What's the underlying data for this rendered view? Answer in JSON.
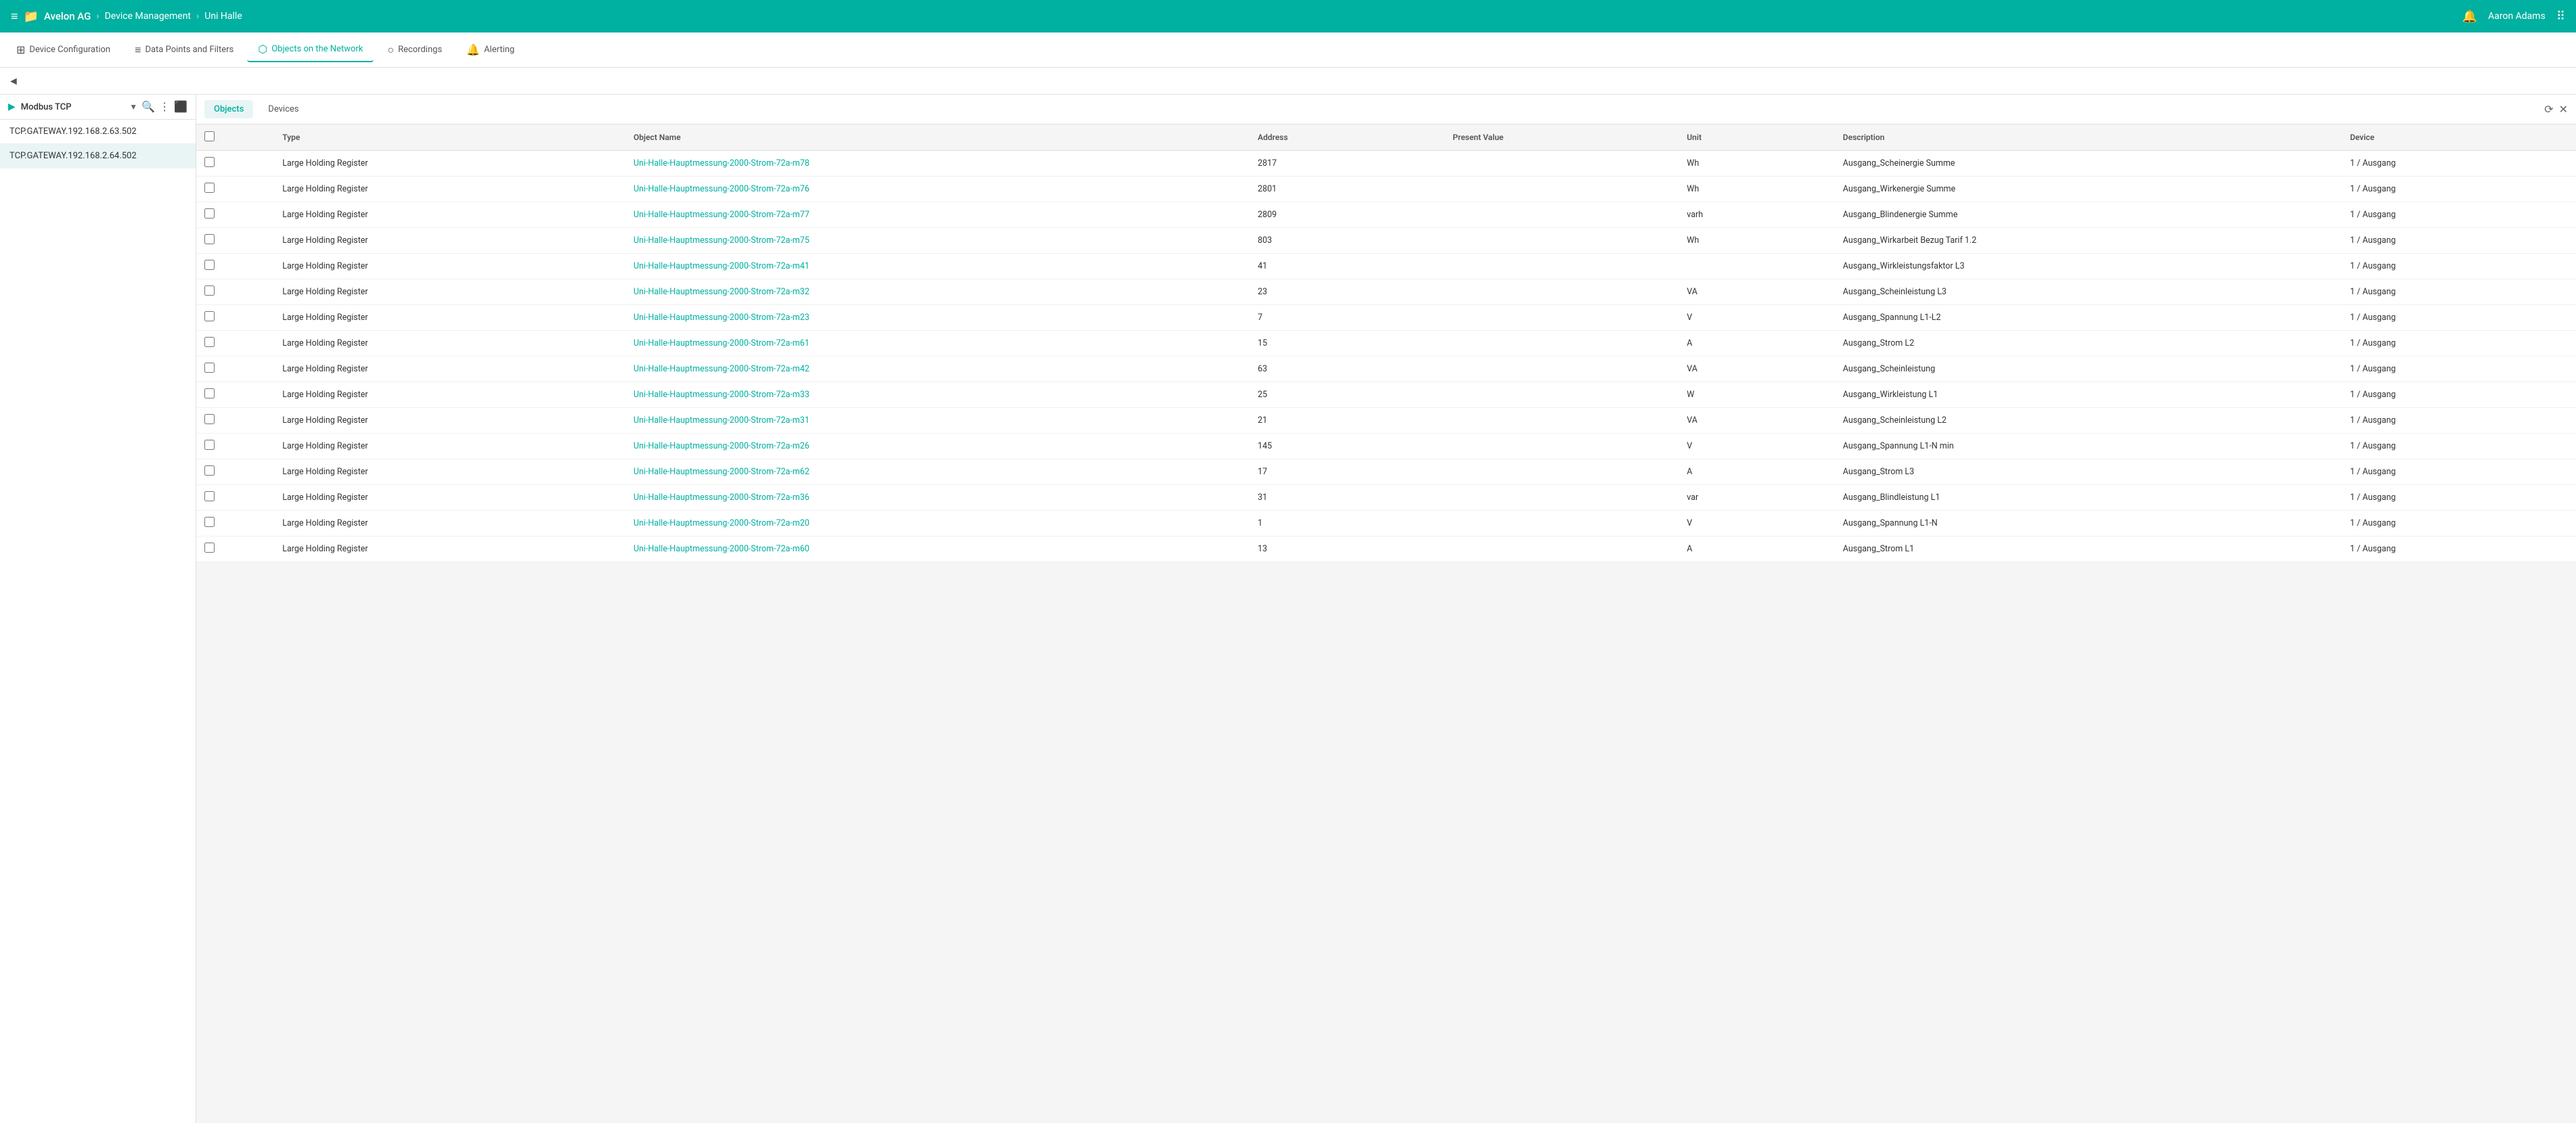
{
  "topNav": {
    "hamburger": "≡",
    "fileIcon": "📁",
    "brand": "Avelon AG",
    "sep1": "›",
    "level1": "Device Management",
    "sep2": "›",
    "level2": "Uni Halle",
    "bellIcon": "🔔",
    "userName": "Aaron Adams",
    "gridIcon": "⠿"
  },
  "tabs": [
    {
      "id": "device-config",
      "label": "Device Configuration",
      "icon": "⊞"
    },
    {
      "id": "data-points",
      "label": "Data Points and Filters",
      "icon": "≡"
    },
    {
      "id": "objects-network",
      "label": "Objects on the Network",
      "icon": "⬡",
      "active": true
    },
    {
      "id": "recordings",
      "label": "Recordings",
      "icon": "○"
    },
    {
      "id": "alerting",
      "label": "Alerting",
      "icon": "🔔"
    }
  ],
  "backButton": "◄",
  "sidebar": {
    "protocol": "Modbus TCP",
    "items": [
      {
        "id": "gateway1",
        "label": "TCP.GATEWAY.192.168.2.63.502",
        "active": false
      },
      {
        "id": "gateway2",
        "label": "TCP.GATEWAY.192.168.2.64.502",
        "active": true
      }
    ]
  },
  "subTabs": [
    {
      "id": "objects",
      "label": "Objects",
      "active": true
    },
    {
      "id": "devices",
      "label": "Devices",
      "active": false
    }
  ],
  "table": {
    "columns": [
      {
        "id": "checkbox",
        "label": ""
      },
      {
        "id": "type",
        "label": "Type"
      },
      {
        "id": "name",
        "label": "Object Name"
      },
      {
        "id": "address",
        "label": "Address"
      },
      {
        "id": "value",
        "label": "Present Value"
      },
      {
        "id": "unit",
        "label": "Unit"
      },
      {
        "id": "description",
        "label": "Description"
      },
      {
        "id": "device",
        "label": "Device"
      }
    ],
    "rows": [
      {
        "type": "Large Holding Register",
        "name": "Uni-Halle-Hauptmessung-2000-Strom-72a-m78",
        "address": "2817",
        "value": "",
        "unit": "Wh",
        "description": "Ausgang_Scheinergie Summe",
        "device": "1 / Ausgang"
      },
      {
        "type": "Large Holding Register",
        "name": "Uni-Halle-Hauptmessung-2000-Strom-72a-m76",
        "address": "2801",
        "value": "",
        "unit": "Wh",
        "description": "Ausgang_Wirkenergie Summe",
        "device": "1 / Ausgang"
      },
      {
        "type": "Large Holding Register",
        "name": "Uni-Halle-Hauptmessung-2000-Strom-72a-m77",
        "address": "2809",
        "value": "",
        "unit": "varh",
        "description": "Ausgang_Blindenergie Summe",
        "device": "1 / Ausgang"
      },
      {
        "type": "Large Holding Register",
        "name": "Uni-Halle-Hauptmessung-2000-Strom-72a-m75",
        "address": "803",
        "value": "",
        "unit": "Wh",
        "description": "Ausgang_Wirkarbeit Bezug Tarif 1.2",
        "device": "1 / Ausgang"
      },
      {
        "type": "Large Holding Register",
        "name": "Uni-Halle-Hauptmessung-2000-Strom-72a-m41",
        "address": "41",
        "value": "",
        "unit": "",
        "description": "Ausgang_Wirkleistungsfaktor L3",
        "device": "1 / Ausgang"
      },
      {
        "type": "Large Holding Register",
        "name": "Uni-Halle-Hauptmessung-2000-Strom-72a-m32",
        "address": "23",
        "value": "",
        "unit": "VA",
        "description": "Ausgang_Scheinleistung L3",
        "device": "1 / Ausgang"
      },
      {
        "type": "Large Holding Register",
        "name": "Uni-Halle-Hauptmessung-2000-Strom-72a-m23",
        "address": "7",
        "value": "",
        "unit": "V",
        "description": "Ausgang_Spannung L1-L2",
        "device": "1 / Ausgang"
      },
      {
        "type": "Large Holding Register",
        "name": "Uni-Halle-Hauptmessung-2000-Strom-72a-m61",
        "address": "15",
        "value": "",
        "unit": "A",
        "description": "Ausgang_Strom L2",
        "device": "1 / Ausgang"
      },
      {
        "type": "Large Holding Register",
        "name": "Uni-Halle-Hauptmessung-2000-Strom-72a-m42",
        "address": "63",
        "value": "",
        "unit": "VA",
        "description": "Ausgang_Scheinleistung",
        "device": "1 / Ausgang"
      },
      {
        "type": "Large Holding Register",
        "name": "Uni-Halle-Hauptmessung-2000-Strom-72a-m33",
        "address": "25",
        "value": "",
        "unit": "W",
        "description": "Ausgang_Wirkleistung L1",
        "device": "1 / Ausgang"
      },
      {
        "type": "Large Holding Register",
        "name": "Uni-Halle-Hauptmessung-2000-Strom-72a-m31",
        "address": "21",
        "value": "",
        "unit": "VA",
        "description": "Ausgang_Scheinleistung L2",
        "device": "1 / Ausgang"
      },
      {
        "type": "Large Holding Register",
        "name": "Uni-Halle-Hauptmessung-2000-Strom-72a-m26",
        "address": "145",
        "value": "",
        "unit": "V",
        "description": "Ausgang_Spannung L1-N min",
        "device": "1 / Ausgang"
      },
      {
        "type": "Large Holding Register",
        "name": "Uni-Halle-Hauptmessung-2000-Strom-72a-m62",
        "address": "17",
        "value": "",
        "unit": "A",
        "description": "Ausgang_Strom L3",
        "device": "1 / Ausgang"
      },
      {
        "type": "Large Holding Register",
        "name": "Uni-Halle-Hauptmessung-2000-Strom-72a-m36",
        "address": "31",
        "value": "",
        "unit": "var",
        "description": "Ausgang_Blindleistung L1",
        "device": "1 / Ausgang"
      },
      {
        "type": "Large Holding Register",
        "name": "Uni-Halle-Hauptmessung-2000-Strom-72a-m20",
        "address": "1",
        "value": "",
        "unit": "V",
        "description": "Ausgang_Spannung L1-N",
        "device": "1 / Ausgang"
      },
      {
        "type": "Large Holding Register",
        "name": "Uni-Halle-Hauptmessung-2000-Strom-72a-m60",
        "address": "13",
        "value": "",
        "unit": "A",
        "description": "Ausgang_Strom L1",
        "device": "1 / Ausgang"
      }
    ]
  }
}
